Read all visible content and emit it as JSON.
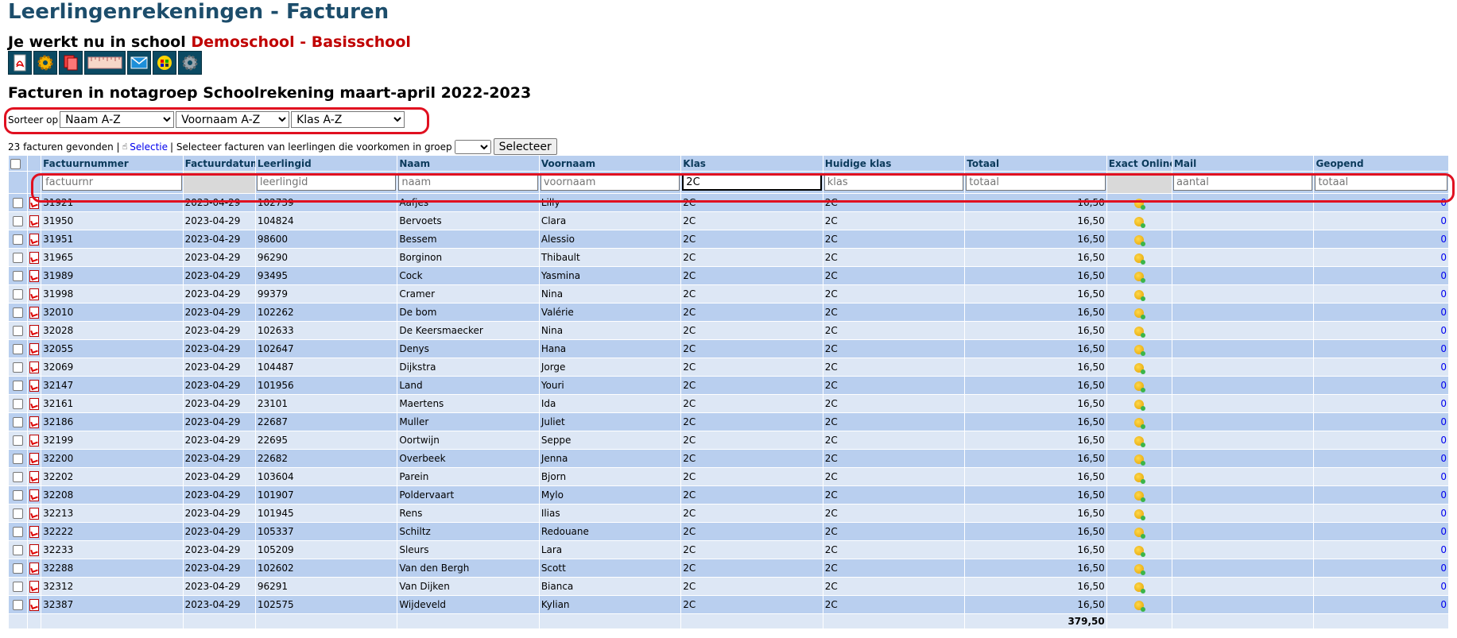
{
  "page_title": "Leerlingenrekeningen - Facturen",
  "school": {
    "prefix": "Je werkt nu in school",
    "name": "Demoschool - Basisschool"
  },
  "toolbar_icons": [
    "pdf-icon",
    "gear-icon",
    "documents-icon",
    "ruler-icon",
    "mail-icon",
    "sync-icon",
    "settings-icon"
  ],
  "section_title": "Facturen in notagroep Schoolrekening maart-april 2022-2023",
  "sort": {
    "label": "Sorteer op",
    "values": [
      "Naam A-Z",
      "Voornaam A-Z",
      "Klas A-Z"
    ]
  },
  "info": {
    "found": "23 facturen gevonden |",
    "selectie_link": "Selectie",
    "select_text": "| Selecteer facturen van leerlingen die voorkomen in groep",
    "group_value": "",
    "button": "Selecteer"
  },
  "columns": [
    "Factuurnummer",
    "Factuurdatum",
    "Leerlingid",
    "Naam",
    "Voornaam",
    "Klas",
    "Huidige klas",
    "Totaal",
    "Exact Online",
    "Mail",
    "Geopend"
  ],
  "filters": {
    "factuurnr": {
      "placeholder": "factuurnr",
      "value": ""
    },
    "leerlingid": {
      "placeholder": "leerlingid",
      "value": ""
    },
    "naam": {
      "placeholder": "naam",
      "value": ""
    },
    "voornaam": {
      "placeholder": "voornaam",
      "value": ""
    },
    "klas": {
      "placeholder": "klas",
      "value": "2C"
    },
    "huidige": {
      "placeholder": "klas",
      "value": ""
    },
    "totaal": {
      "placeholder": "totaal",
      "value": ""
    },
    "mail": {
      "placeholder": "aantal",
      "value": ""
    },
    "geopend": {
      "placeholder": "totaal",
      "value": ""
    }
  },
  "rows": [
    {
      "nr": "31921",
      "datum": "2023-04-29",
      "id": "102739",
      "naam": "Aafjes",
      "voornaam": "Lilly",
      "klas": "2C",
      "huidig": "2C",
      "totaal": "16,50",
      "geopend": "0"
    },
    {
      "nr": "31950",
      "datum": "2023-04-29",
      "id": "104824",
      "naam": "Bervoets",
      "voornaam": "Clara",
      "klas": "2C",
      "huidig": "2C",
      "totaal": "16,50",
      "geopend": "0"
    },
    {
      "nr": "31951",
      "datum": "2023-04-29",
      "id": "98600",
      "naam": "Bessem",
      "voornaam": "Alessio",
      "klas": "2C",
      "huidig": "2C",
      "totaal": "16,50",
      "geopend": "0"
    },
    {
      "nr": "31965",
      "datum": "2023-04-29",
      "id": "96290",
      "naam": "Borginon",
      "voornaam": "Thibault",
      "klas": "2C",
      "huidig": "2C",
      "totaal": "16,50",
      "geopend": "0"
    },
    {
      "nr": "31989",
      "datum": "2023-04-29",
      "id": "93495",
      "naam": "Cock",
      "voornaam": "Yasmina",
      "klas": "2C",
      "huidig": "2C",
      "totaal": "16,50",
      "geopend": "0"
    },
    {
      "nr": "31998",
      "datum": "2023-04-29",
      "id": "99379",
      "naam": "Cramer",
      "voornaam": "Nina",
      "klas": "2C",
      "huidig": "2C",
      "totaal": "16,50",
      "geopend": "0"
    },
    {
      "nr": "32010",
      "datum": "2023-04-29",
      "id": "102262",
      "naam": "De bom",
      "voornaam": "Valérie",
      "klas": "2C",
      "huidig": "2C",
      "totaal": "16,50",
      "geopend": "0"
    },
    {
      "nr": "32028",
      "datum": "2023-04-29",
      "id": "102633",
      "naam": "De Keersmaecker",
      "voornaam": "Nina",
      "klas": "2C",
      "huidig": "2C",
      "totaal": "16,50",
      "geopend": "0"
    },
    {
      "nr": "32055",
      "datum": "2023-04-29",
      "id": "102647",
      "naam": "Denys",
      "voornaam": "Hana",
      "klas": "2C",
      "huidig": "2C",
      "totaal": "16,50",
      "geopend": "0"
    },
    {
      "nr": "32069",
      "datum": "2023-04-29",
      "id": "104487",
      "naam": "Dijkstra",
      "voornaam": "Jorge",
      "klas": "2C",
      "huidig": "2C",
      "totaal": "16,50",
      "geopend": "0"
    },
    {
      "nr": "32147",
      "datum": "2023-04-29",
      "id": "101956",
      "naam": "Land",
      "voornaam": "Youri",
      "klas": "2C",
      "huidig": "2C",
      "totaal": "16,50",
      "geopend": "0"
    },
    {
      "nr": "32161",
      "datum": "2023-04-29",
      "id": "23101",
      "naam": "Maertens",
      "voornaam": "Ida",
      "klas": "2C",
      "huidig": "2C",
      "totaal": "16,50",
      "geopend": "0"
    },
    {
      "nr": "32186",
      "datum": "2023-04-29",
      "id": "22687",
      "naam": "Muller",
      "voornaam": "Juliet",
      "klas": "2C",
      "huidig": "2C",
      "totaal": "16,50",
      "geopend": "0"
    },
    {
      "nr": "32199",
      "datum": "2023-04-29",
      "id": "22695",
      "naam": "Oortwijn",
      "voornaam": "Seppe",
      "klas": "2C",
      "huidig": "2C",
      "totaal": "16,50",
      "geopend": "0"
    },
    {
      "nr": "32200",
      "datum": "2023-04-29",
      "id": "22682",
      "naam": "Overbeek",
      "voornaam": "Jenna",
      "klas": "2C",
      "huidig": "2C",
      "totaal": "16,50",
      "geopend": "0"
    },
    {
      "nr": "32202",
      "datum": "2023-04-29",
      "id": "103604",
      "naam": "Parein",
      "voornaam": "Bjorn",
      "klas": "2C",
      "huidig": "2C",
      "totaal": "16,50",
      "geopend": "0"
    },
    {
      "nr": "32208",
      "datum": "2023-04-29",
      "id": "101907",
      "naam": "Poldervaart",
      "voornaam": "Mylo",
      "klas": "2C",
      "huidig": "2C",
      "totaal": "16,50",
      "geopend": "0"
    },
    {
      "nr": "32213",
      "datum": "2023-04-29",
      "id": "101945",
      "naam": "Rens",
      "voornaam": "Ilias",
      "klas": "2C",
      "huidig": "2C",
      "totaal": "16,50",
      "geopend": "0"
    },
    {
      "nr": "32222",
      "datum": "2023-04-29",
      "id": "105337",
      "naam": "Schiltz",
      "voornaam": "Redouane",
      "klas": "2C",
      "huidig": "2C",
      "totaal": "16,50",
      "geopend": "0"
    },
    {
      "nr": "32233",
      "datum": "2023-04-29",
      "id": "105209",
      "naam": "Sleurs",
      "voornaam": "Lara",
      "klas": "2C",
      "huidig": "2C",
      "totaal": "16,50",
      "geopend": "0"
    },
    {
      "nr": "32288",
      "datum": "2023-04-29",
      "id": "102602",
      "naam": "Van den Bergh",
      "voornaam": "Scott",
      "klas": "2C",
      "huidig": "2C",
      "totaal": "16,50",
      "geopend": "0"
    },
    {
      "nr": "32312",
      "datum": "2023-04-29",
      "id": "96291",
      "naam": "Van Dijken",
      "voornaam": "Bianca",
      "klas": "2C",
      "huidig": "2C",
      "totaal": "16,50",
      "geopend": "0"
    },
    {
      "nr": "32387",
      "datum": "2023-04-29",
      "id": "102575",
      "naam": "Wijdeveld",
      "voornaam": "Kylian",
      "klas": "2C",
      "huidig": "2C",
      "totaal": "16,50",
      "geopend": "0"
    }
  ],
  "footer_total": "379,50",
  "colors": {
    "title": "#1c4d6b",
    "school_name": "#c00000",
    "header_bg": "#b9cfef",
    "row_alt": "#dde7f5",
    "highlight": "#e01020"
  }
}
